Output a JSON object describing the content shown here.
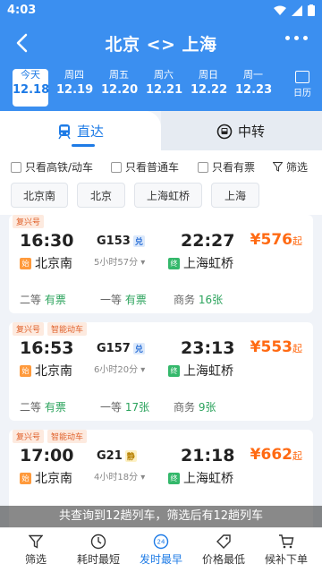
{
  "status": {
    "time": "4:03"
  },
  "header": {
    "title": "北京 <> 上海"
  },
  "dates": [
    {
      "weekday": "今天",
      "date": "12.18",
      "active": true
    },
    {
      "weekday": "周四",
      "date": "12.19"
    },
    {
      "weekday": "周五",
      "date": "12.20"
    },
    {
      "weekday": "周六",
      "date": "12.21"
    },
    {
      "weekday": "周日",
      "date": "12.22"
    },
    {
      "weekday": "周一",
      "date": "12.23"
    }
  ],
  "calendar_label": "日历",
  "tabs": {
    "direct": "直达",
    "transfer": "中转"
  },
  "filters": {
    "high_speed": "只看高铁/动车",
    "normal": "只看普通车",
    "available": "只看有票",
    "filter": "筛选"
  },
  "stations": [
    "北京南",
    "北京",
    "上海虹桥",
    "上海"
  ],
  "trains": [
    {
      "badges": [
        "复兴号"
      ],
      "dep_time": "16:30",
      "arr_time": "22:27",
      "train_no": "G153",
      "tag": "兑",
      "duration": "5小时57分",
      "dep_station": "北京南",
      "arr_station": "上海虹桥",
      "price": "¥576",
      "price_suffix": "起",
      "seats": [
        {
          "name": "二等",
          "value": "有票"
        },
        {
          "name": "一等",
          "value": "有票"
        },
        {
          "name": "商务",
          "value": "16张"
        }
      ]
    },
    {
      "badges": [
        "复兴号",
        "智能动车"
      ],
      "dep_time": "16:53",
      "arr_time": "23:13",
      "train_no": "G157",
      "tag": "兑",
      "duration": "6小时20分",
      "dep_station": "北京南",
      "arr_station": "上海虹桥",
      "price": "¥553",
      "price_suffix": "起",
      "seats": [
        {
          "name": "二等",
          "value": "有票"
        },
        {
          "name": "一等",
          "value": "17张"
        },
        {
          "name": "商务",
          "value": "9张"
        }
      ]
    },
    {
      "badges": [
        "复兴号",
        "智能动车"
      ],
      "dep_time": "17:00",
      "arr_time": "21:18",
      "train_no": "G21",
      "tag": "静",
      "duration": "4小时18分",
      "dep_station": "北京南",
      "arr_station": "上海虹桥",
      "price": "¥662",
      "price_suffix": "起"
    }
  ],
  "start_label": "始",
  "end_label": "终",
  "toast": "共查询到12趟列车，筛选后有12趟列车",
  "bottom_nav": [
    {
      "label": "筛选"
    },
    {
      "label": "耗时最短"
    },
    {
      "label": "发时最早",
      "active": true
    },
    {
      "label": "价格最低"
    },
    {
      "label": "候补下单"
    }
  ],
  "colors": {
    "primary": "#3b8ff0",
    "accent": "#1e7be6",
    "price": "#ff6a13",
    "available": "#2ba35c"
  }
}
